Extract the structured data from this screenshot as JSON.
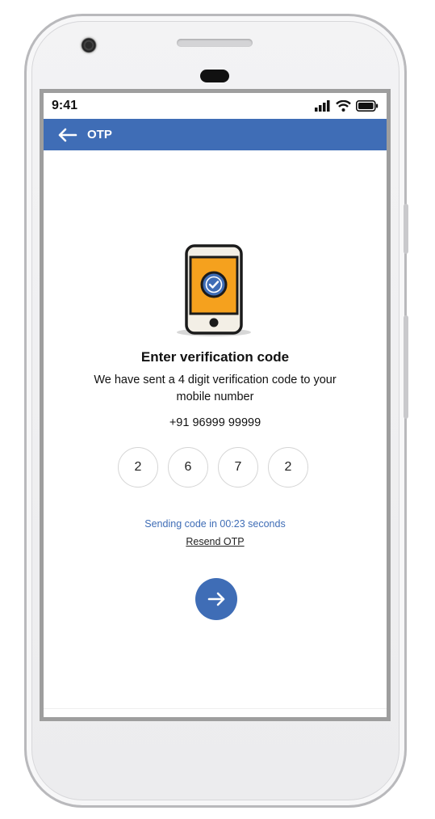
{
  "status_bar": {
    "time": "9:41"
  },
  "app_bar": {
    "title": "OTP"
  },
  "otp_screen": {
    "heading": "Enter verification code",
    "description": "We have sent a 4 digit verification code to your mobile number",
    "phone_number": "+91 96999 99999",
    "digits": [
      "2",
      "6",
      "7",
      "2"
    ],
    "timer_text": "Sending code in 00:23 seconds",
    "resend_label": "Resend OTP"
  },
  "colors": {
    "primary": "#3f6db6",
    "illustration_orange": "#f5a11e"
  },
  "icons": {
    "back": "arrow-left-icon",
    "next": "arrow-right-icon",
    "illustration": "smartphone-check-icon"
  }
}
